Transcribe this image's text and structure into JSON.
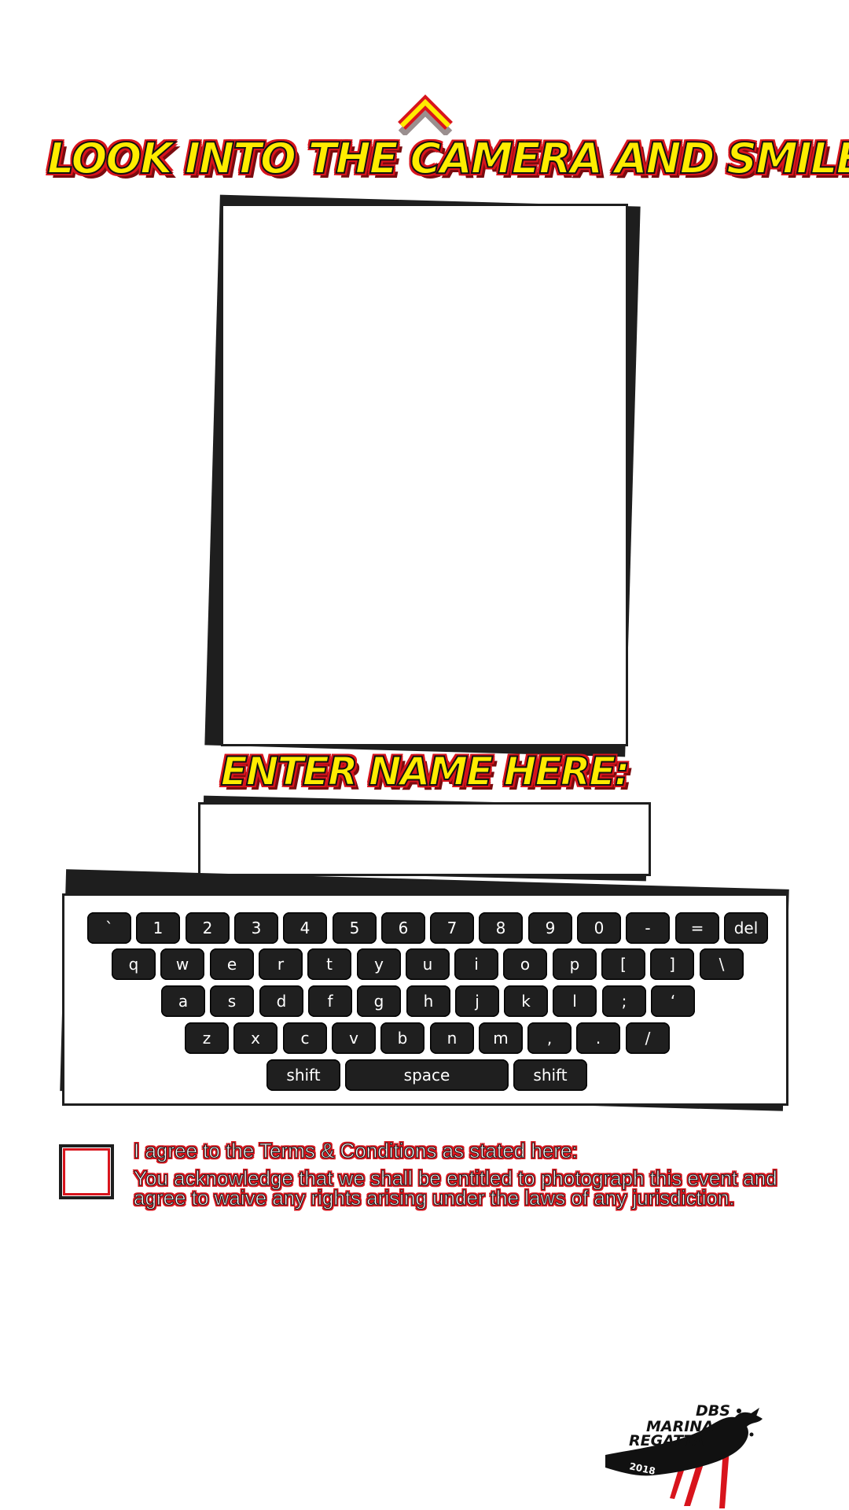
{
  "camera_prompt": "LOOK INTO THE CAMERA AND SMILE",
  "name_prompt": "ENTER NAME HERE:",
  "name_input": {
    "value": "",
    "placeholder": ""
  },
  "keyboard": {
    "rows": [
      [
        "`",
        "1",
        "2",
        "3",
        "4",
        "5",
        "6",
        "7",
        "8",
        "9",
        "0",
        "-",
        "=",
        "del"
      ],
      [
        "q",
        "w",
        "e",
        "r",
        "t",
        "y",
        "u",
        "i",
        "o",
        "p",
        "[",
        "]",
        "\\"
      ],
      [
        "a",
        "s",
        "d",
        "f",
        "g",
        "h",
        "j",
        "k",
        "l",
        ";",
        "‘"
      ],
      [
        "z",
        "x",
        "c",
        "v",
        "b",
        "n",
        "m",
        ",",
        ".",
        "/"
      ],
      [
        "shift",
        "space",
        "shift"
      ]
    ]
  },
  "terms": {
    "heading": "I agree to the Terms & Conditions as stated here:",
    "body_line1": "You acknowledge that we shall be entitled to photograph this event and",
    "body_line2": "agree to waive any rights arising under the laws of any jurisdiction.",
    "checked": false
  },
  "logo": {
    "line1": "DBS",
    "line2": "MARINA",
    "line3": "REGATTA",
    "year": "2018"
  },
  "colors": {
    "accent_yellow": "#ffec00",
    "accent_red": "#d8141c",
    "key_dark": "#1f1f1f"
  },
  "icons": {
    "up": "chevron-up-icon"
  }
}
